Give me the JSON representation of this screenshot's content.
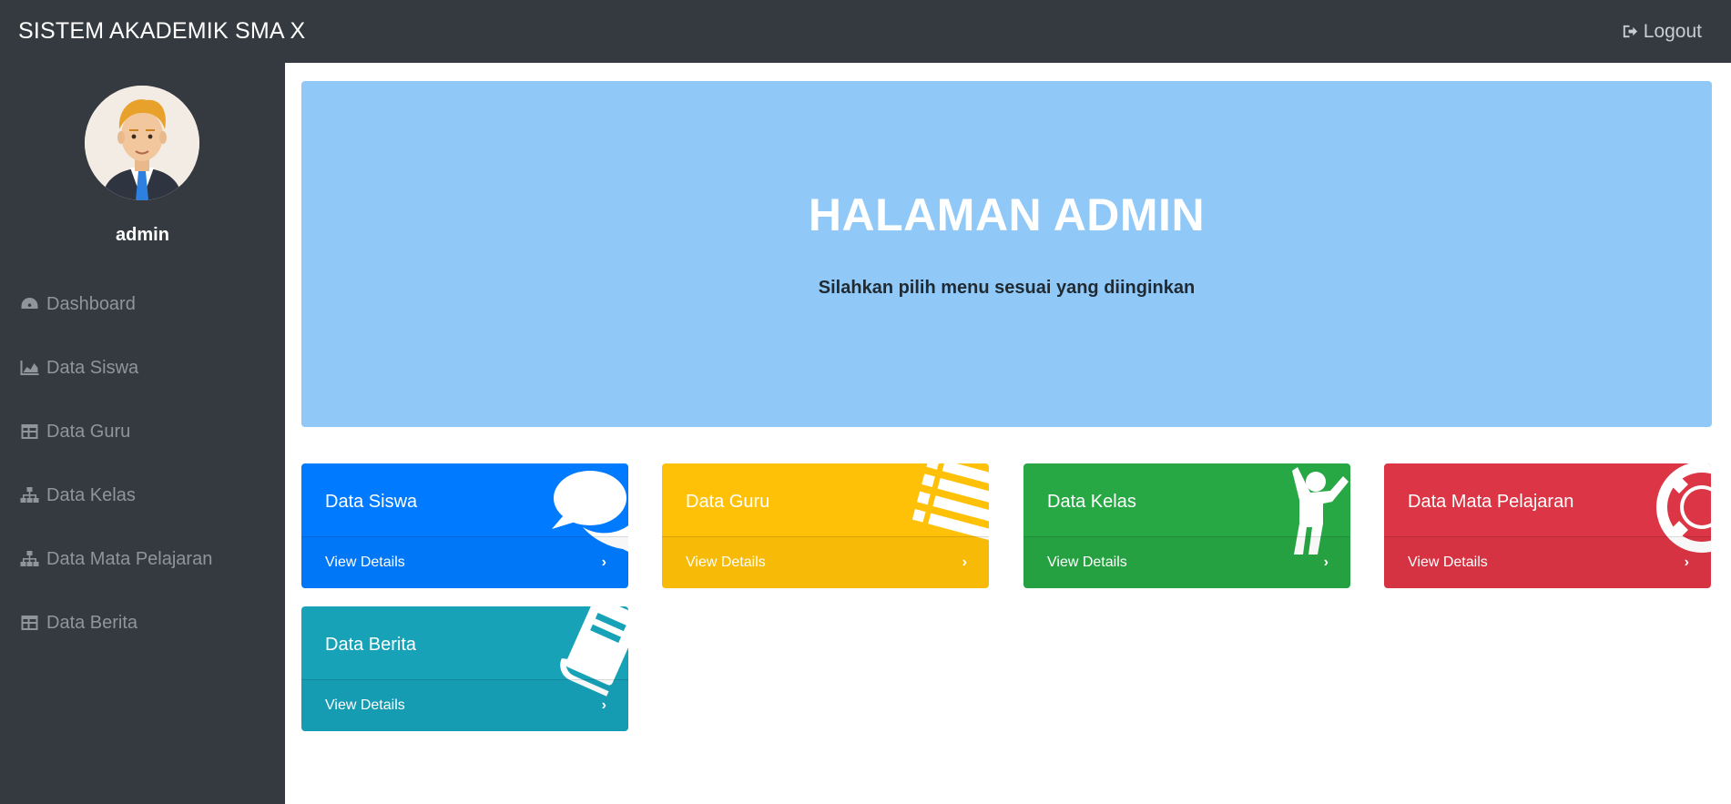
{
  "header": {
    "brand": "SISTEM AKADEMIK SMA X",
    "logout_label": "Logout"
  },
  "sidebar": {
    "username": "admin",
    "items": [
      {
        "label": "Dashboard",
        "icon": "dashboard-icon"
      },
      {
        "label": "Data Siswa",
        "icon": "area-chart-icon"
      },
      {
        "label": "Data Guru",
        "icon": "table-icon"
      },
      {
        "label": "Data Kelas",
        "icon": "sitemap-icon"
      },
      {
        "label": "Data Mata Pelajaran",
        "icon": "sitemap-icon"
      },
      {
        "label": "Data Berita",
        "icon": "table-icon"
      }
    ]
  },
  "jumbotron": {
    "title": "HALAMAN ADMIN",
    "subtitle": "Silahkan pilih menu sesuai yang diinginkan"
  },
  "cards": [
    {
      "title": "Data Siswa",
      "link": "View Details",
      "color": "#007bff",
      "icon": "comments-icon"
    },
    {
      "title": "Data Guru",
      "link": "View Details",
      "color": "#ffc107",
      "icon": "list-icon"
    },
    {
      "title": "Data Kelas",
      "link": "View Details",
      "color": "#28a745",
      "icon": "child-icon"
    },
    {
      "title": "Data Mata Pelajaran",
      "link": "View Details",
      "color": "#dc3545",
      "icon": "life-ring-icon"
    },
    {
      "title": "Data Berita",
      "link": "View Details",
      "color": "#17a2b8",
      "icon": "book-icon"
    }
  ]
}
